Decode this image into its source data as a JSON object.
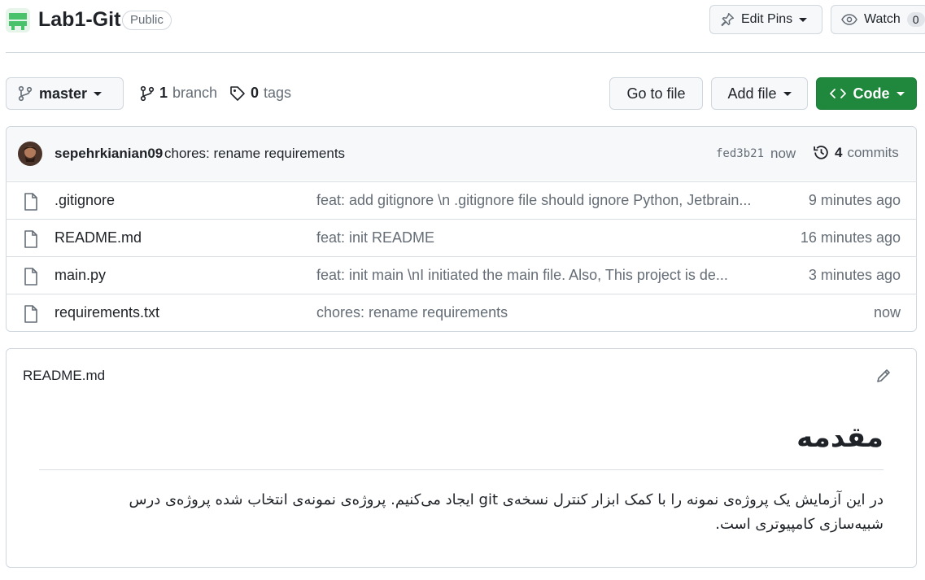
{
  "repo": {
    "name": "Lab1-Git",
    "visibility": "Public",
    "edit_pins_label": "Edit Pins",
    "watch_label": "Watch",
    "watch_count": "0"
  },
  "toolbar": {
    "branch_name": "master",
    "branch_count": "1",
    "branch_label": "branch",
    "tag_count": "0",
    "tag_label": "tags",
    "go_to_file": "Go to file",
    "add_file": "Add file",
    "code": "Code"
  },
  "latest_commit": {
    "author": "sepehrkianian09",
    "message": "chores: rename requirements",
    "sha": "fed3b21",
    "time": "now",
    "commit_count": "4",
    "commit_label": "commits"
  },
  "files": [
    {
      "name": ".gitignore",
      "message": "feat: add gitignore \\n .gitignore file should ignore Python, Jetbrain...",
      "time": "9 minutes ago"
    },
    {
      "name": "README.md",
      "message": "feat: init README",
      "time": "16 minutes ago"
    },
    {
      "name": "main.py",
      "message": "feat: init main \\nI initiated the main file. Also, This project is de...",
      "time": "3 minutes ago"
    },
    {
      "name": "requirements.txt",
      "message": "chores: rename requirements",
      "time": "now"
    }
  ],
  "readme": {
    "filename": "README.md",
    "heading": "مقدمه",
    "body": "در این آزمایش یک پروژه‌ی نمونه را با کمک ابزار کنترل نسخه‌ی git ایجاد می‌کنیم. پروژه‌ی نمونه‌ی انتخاب شده پروژه‌ی درس شبیه‌سازی کامپیوتری است."
  },
  "colors": {
    "accent_green": "#1f883d",
    "border": "#d0d7de",
    "muted": "#656d76"
  }
}
